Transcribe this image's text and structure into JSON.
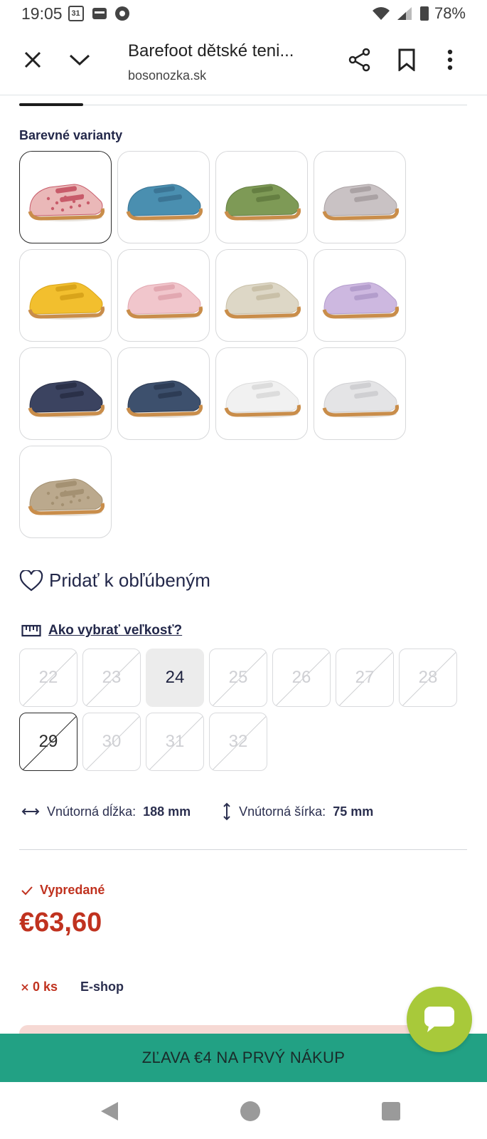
{
  "status_bar": {
    "time": "19:05",
    "calendar_day": "31",
    "battery": "78%"
  },
  "browser": {
    "title": "Barefoot dětské teni...",
    "url": "bosonozka.sk"
  },
  "variants": {
    "heading": "Barevné varianty",
    "items": [
      {
        "color": "#eab8b8",
        "accent": "#c85b6a",
        "pattern": "dots",
        "selected": true
      },
      {
        "color": "#4a8fb0",
        "accent": "#3b7595",
        "pattern": "none",
        "selected": false
      },
      {
        "color": "#7e9a56",
        "accent": "#657f42",
        "pattern": "none",
        "selected": false
      },
      {
        "color": "#c9c2c4",
        "accent": "#aaa2a4",
        "pattern": "none",
        "selected": false
      },
      {
        "color": "#f2bf2e",
        "accent": "#d9a41a",
        "pattern": "none",
        "selected": false
      },
      {
        "color": "#f1c6cc",
        "accent": "#e2a8b1",
        "pattern": "none",
        "selected": false
      },
      {
        "color": "#ddd7c6",
        "accent": "#c9c0a8",
        "pattern": "none",
        "selected": false
      },
      {
        "color": "#cdb8e0",
        "accent": "#b39dcc",
        "pattern": "none",
        "selected": false
      },
      {
        "color": "#3b4360",
        "accent": "#2a3048",
        "pattern": "none",
        "selected": false
      },
      {
        "color": "#3d506d",
        "accent": "#2d3c55",
        "pattern": "none",
        "selected": false
      },
      {
        "color": "#f1f1f1",
        "accent": "#dcdcdc",
        "pattern": "none",
        "selected": false
      },
      {
        "color": "#e4e4e6",
        "accent": "#cfcfd2",
        "pattern": "none",
        "selected": false
      },
      {
        "color": "#bba98d",
        "accent": "#a49172",
        "pattern": "dots",
        "selected": false
      }
    ]
  },
  "favorite": {
    "label": "Pridať k obľúbeným"
  },
  "sizes": {
    "guide_label": "Ako vybrať veľkosť?",
    "items": [
      {
        "label": "22",
        "state": "unavailable"
      },
      {
        "label": "23",
        "state": "unavailable"
      },
      {
        "label": "24",
        "state": "available"
      },
      {
        "label": "25",
        "state": "unavailable"
      },
      {
        "label": "26",
        "state": "unavailable"
      },
      {
        "label": "27",
        "state": "unavailable"
      },
      {
        "label": "28",
        "state": "unavailable"
      },
      {
        "label": "29",
        "state": "selected"
      },
      {
        "label": "30",
        "state": "unavailable"
      },
      {
        "label": "31",
        "state": "unavailable"
      },
      {
        "label": "32",
        "state": "unavailable"
      }
    ]
  },
  "dimensions": {
    "length_label": "Vnútorná dĺžka:",
    "length_value": "188 mm",
    "width_label": "Vnútorná šírka:",
    "width_value": "75 mm"
  },
  "stock": {
    "status": "Vypredané",
    "price": "€63,60",
    "quantity": "0 ks",
    "location": "E-shop"
  },
  "promo": {
    "text": "ZĽAVA €4 NA PRVÝ NÁKUP"
  },
  "colors": {
    "sale_red": "#c0321f",
    "promo_green": "#22a184",
    "chat_green": "#a8c93a",
    "navy": "#23284a"
  }
}
